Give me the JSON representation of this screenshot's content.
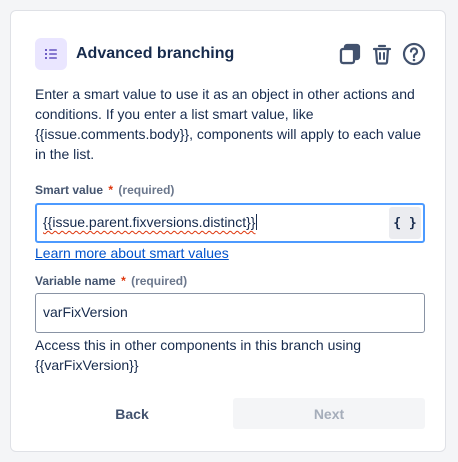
{
  "header": {
    "title": "Advanced branching",
    "type_icon": "list-icon",
    "tools": [
      "copy-icon",
      "trash-icon",
      "help-icon"
    ]
  },
  "description": "Enter a smart value to use it as an object in other actions and conditions. If you enter a list smart value, like {{issue.comments.body}}, components will apply to each value in the list.",
  "smart_value": {
    "label": "Smart value",
    "required_star": "*",
    "required_text": "(required)",
    "value": "{{issue.parent.fixversions.distinct}}",
    "button_label": "{ }"
  },
  "learn_more_link": "Learn more about smart values",
  "variable_name": {
    "label": "Variable name",
    "required_star": "*",
    "required_text": "(required)",
    "value": "varFixVersion"
  },
  "help_text": "Access this in other components in this branch using {{varFixVersion}}",
  "buttons": {
    "back": "Back",
    "next": "Next"
  },
  "colors": {
    "accent_purple": "#6554c0",
    "focus_border": "#4c9aff",
    "link": "#0052cc",
    "required": "#de350b"
  }
}
